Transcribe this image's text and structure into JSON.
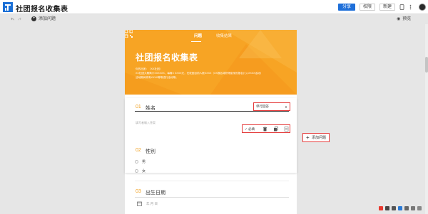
{
  "app": {
    "title": "社团报名收集表"
  },
  "header": {
    "share_label": "分享",
    "perm_label": "权限",
    "new_label": "新建"
  },
  "toolbar": {
    "add_question_label": "添加问题",
    "preview_label": "预览"
  },
  "form": {
    "tabs": [
      "问题",
      "收集结果"
    ],
    "title": "社团报名收集表",
    "description": [
      "你的社团：（XX社团）",
      "XX社团大概简介XXXXXX，每周X XXXX天，在校园目前人数XXXX（XX报名将获得宣传的报名计入XXXX活动）",
      "活动期间将有XXXX等等进行活动等。"
    ],
    "questions": [
      {
        "num": "01",
        "title": "姓名",
        "type": "单行回答",
        "placeholder": "填写者输入答案"
      },
      {
        "num": "02",
        "title": "性别",
        "options": [
          "男",
          "女"
        ]
      },
      {
        "num": "03",
        "title": "出生日期",
        "date_text": "年 月 日"
      }
    ],
    "required_label": "必填",
    "add_question_side_label": "添加问题"
  },
  "colors": {
    "accent": "#f7a424",
    "highlight": "#e43b3b",
    "primary": "#1e6fd9"
  }
}
